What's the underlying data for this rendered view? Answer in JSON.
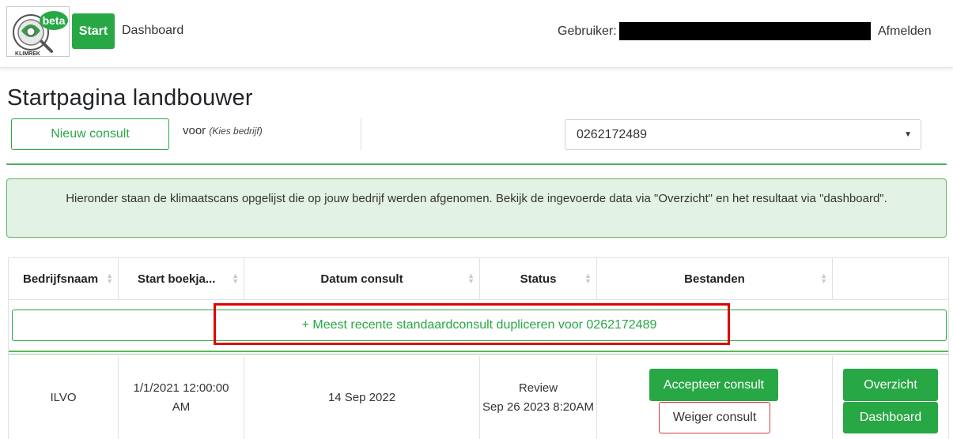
{
  "navbar": {
    "logo_badge": "beta",
    "logo_text": "KLIMREK",
    "start_label": "Start",
    "dashboard_link": "Dashboard",
    "user_label": "Gebruiker:",
    "logout_label": "Afmelden"
  },
  "page_title": "Startpagina landbouwer",
  "toolbar": {
    "new_consult_label": "Nieuw consult",
    "voor_label": "voor",
    "voor_hint": "(Kies bedrijf)",
    "company_select_value": "0262172489"
  },
  "info_text": "Hieronder staan de klimaatscans opgelijst die op jouw bedrijf werden afgenomen. Bekijk de ingevoerde data via \"Overzicht\" en het resultaat via \"dashboard\".",
  "table": {
    "columns": [
      "Bedrijfsnaam",
      "Start boekja...",
      "Datum consult",
      "Status",
      "Bestanden",
      ""
    ],
    "duplicate_label": "+ Meest recente standaardconsult dupliceren voor 0262172489",
    "rows": [
      {
        "bedrijfsnaam": "ILVO",
        "start_boekjaar_line1": "1/1/2021 12:00:00",
        "start_boekjaar_line2": "AM",
        "datum_consult": "14 Sep 2022",
        "status_line1": "Review",
        "status_line2": "Sep 26 2023 8:20AM",
        "accept_label": "Accepteer consult",
        "reject_label": "Weiger consult",
        "overview_label": "Overzicht",
        "dashboard_label": "Dashboard"
      }
    ]
  },
  "colors": {
    "success": "#28a745",
    "danger": "#dc3545",
    "info_bg": "#e2f2e4",
    "highlight": "#e00000"
  }
}
